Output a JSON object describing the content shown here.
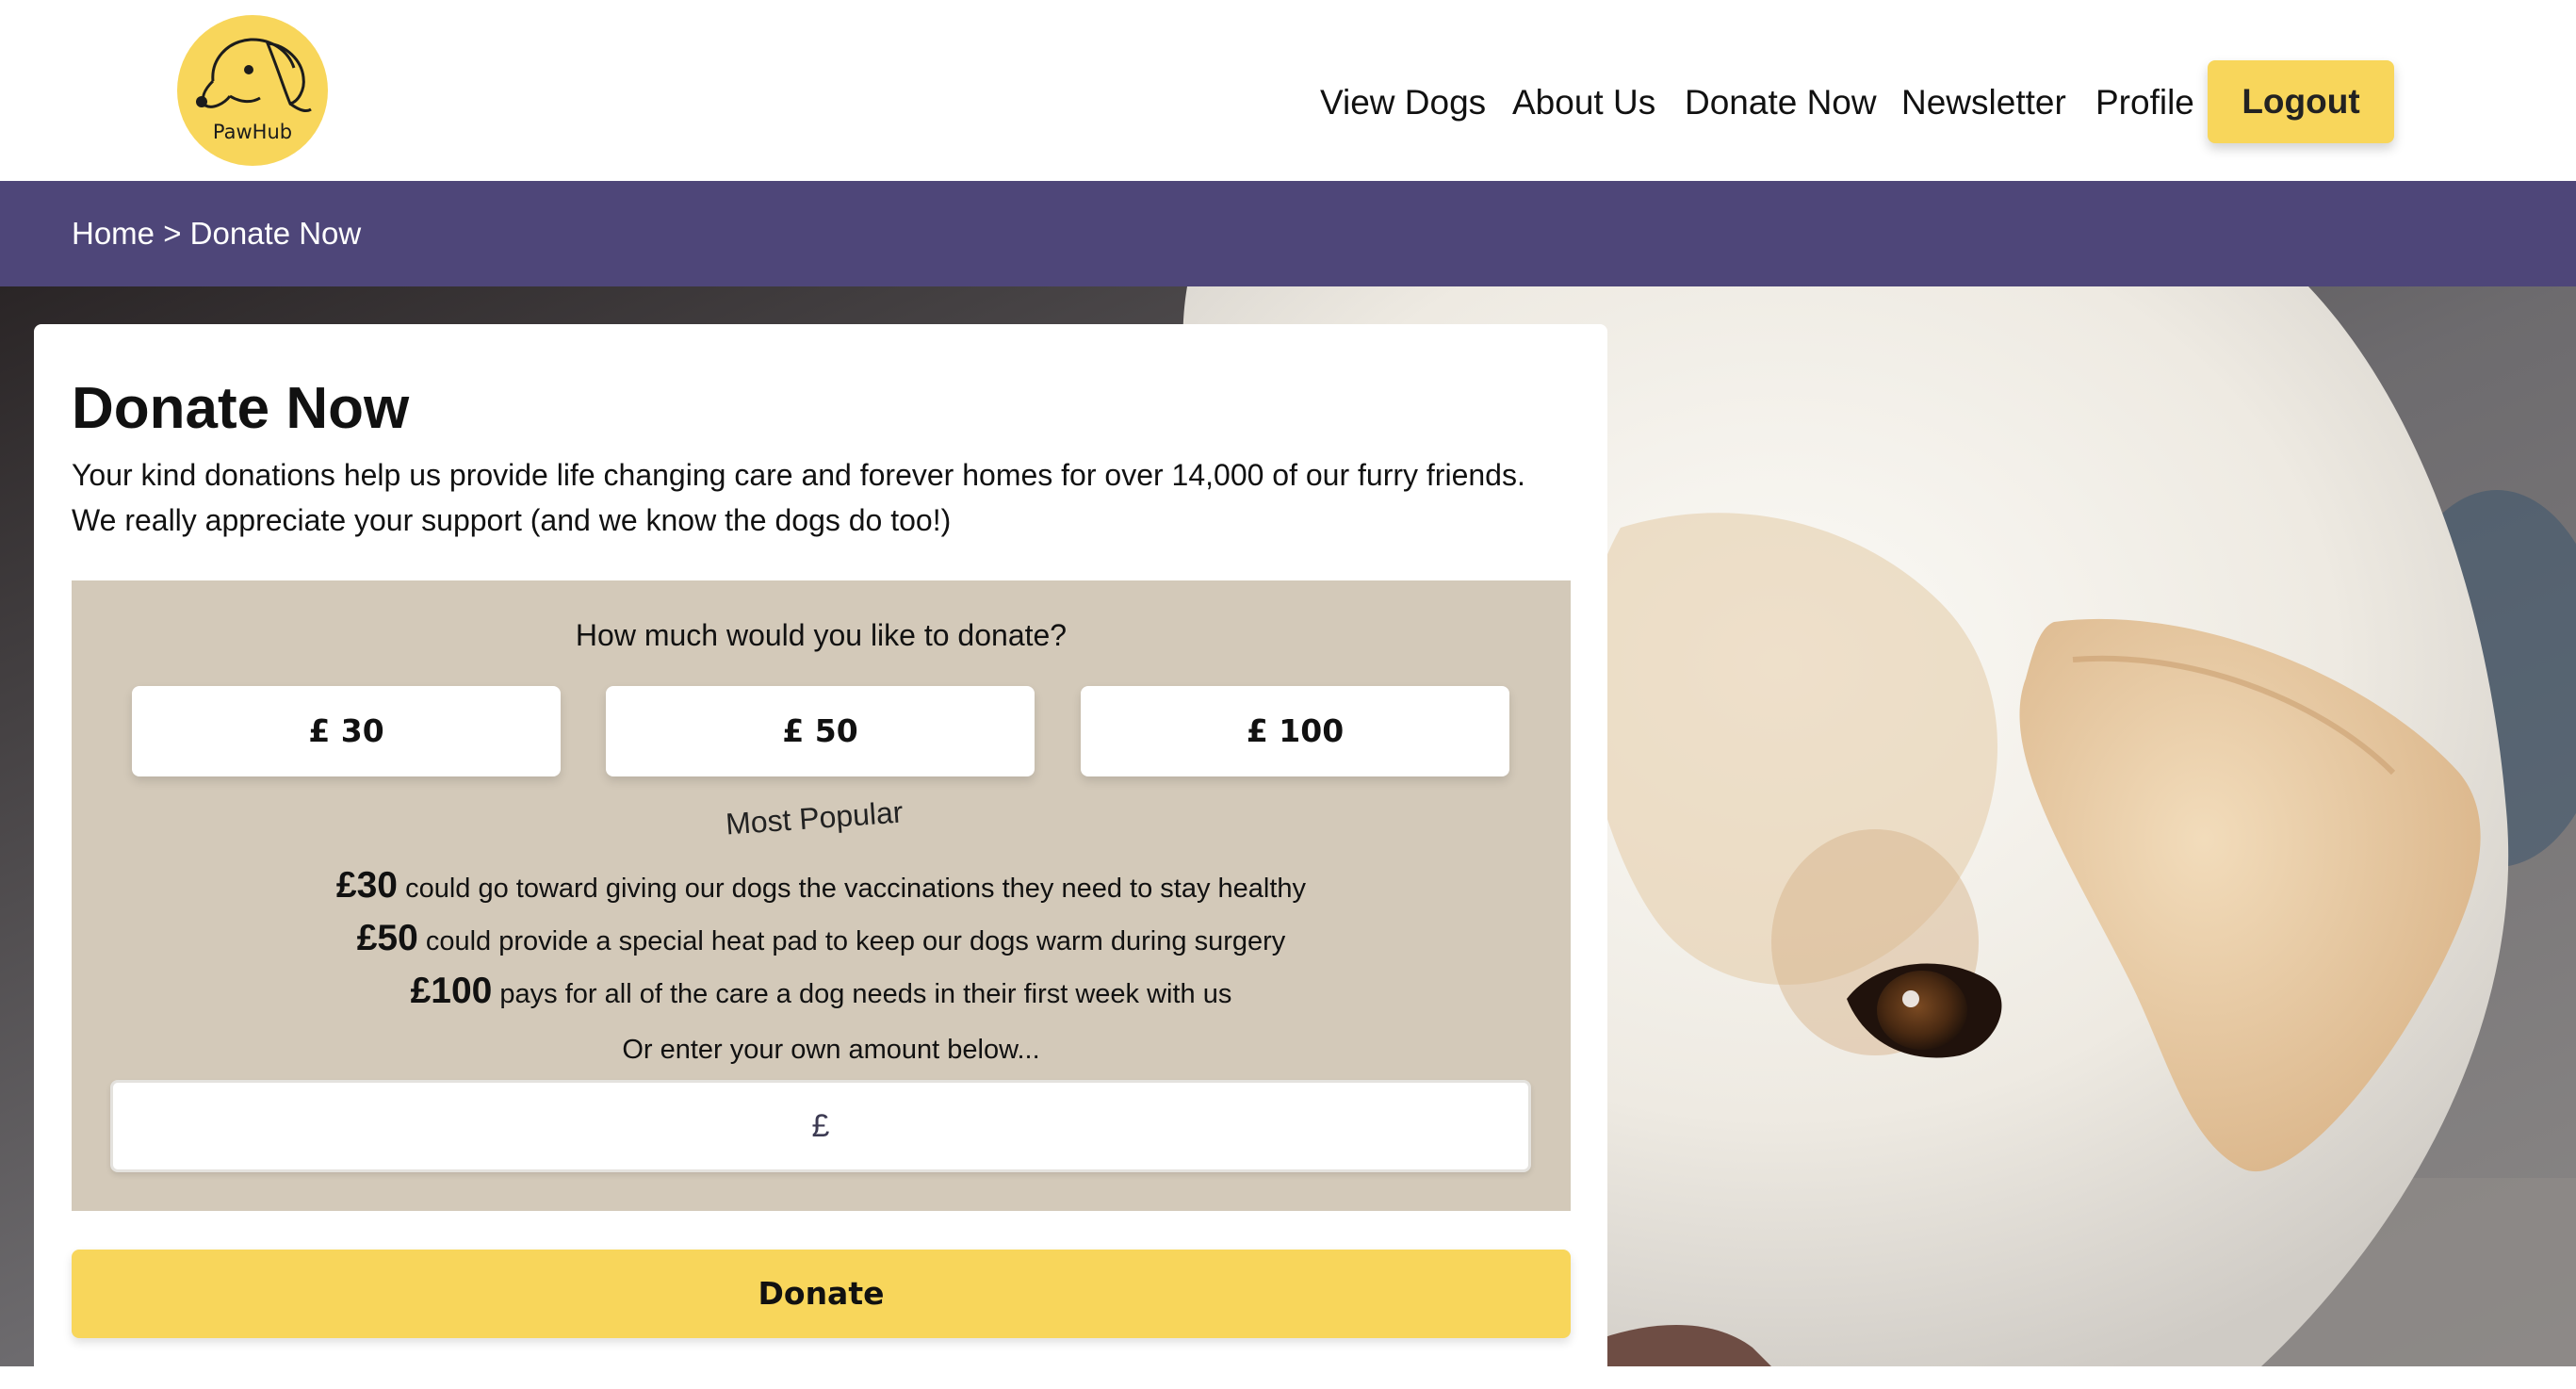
{
  "brand": {
    "name": "PawHub",
    "logo_color": "#f8d65b"
  },
  "nav": {
    "items": [
      "View Dogs",
      "About Us",
      "Donate Now",
      "Newsletter",
      "Profile"
    ],
    "logout_label": "Logout"
  },
  "breadcrumb": {
    "text": "Home > Donate Now"
  },
  "colors": {
    "accent": "#f8d65b",
    "breadcrumb_bar": "#4e4679",
    "panel": "#d3c9b9"
  },
  "main": {
    "title": "Donate Now",
    "intro_line1": "Your kind donations help us provide life changing care and forever homes for over 14,000 of our furry friends.",
    "intro_line2": "We really appreciate your support (and we know the dogs do too!)"
  },
  "donation": {
    "question": "How much would you like to donate?",
    "amounts": [
      "£ 30",
      "£ 50",
      "£ 100"
    ],
    "popular_label": "Most Popular",
    "impacts": [
      {
        "amount": "£30",
        "text": "could go toward giving our dogs the vaccinations they need to stay healthy"
      },
      {
        "amount": "£50",
        "text": "could provide a special heat pad to keep our dogs warm during surgery"
      },
      {
        "amount": "£100",
        "text": "pays for all of the care a dog needs in their first week with us"
      }
    ],
    "own_amount_label": "Or enter your own amount below...",
    "own_amount_placeholder": "£",
    "own_amount_value": "",
    "donate_label": "Donate"
  }
}
